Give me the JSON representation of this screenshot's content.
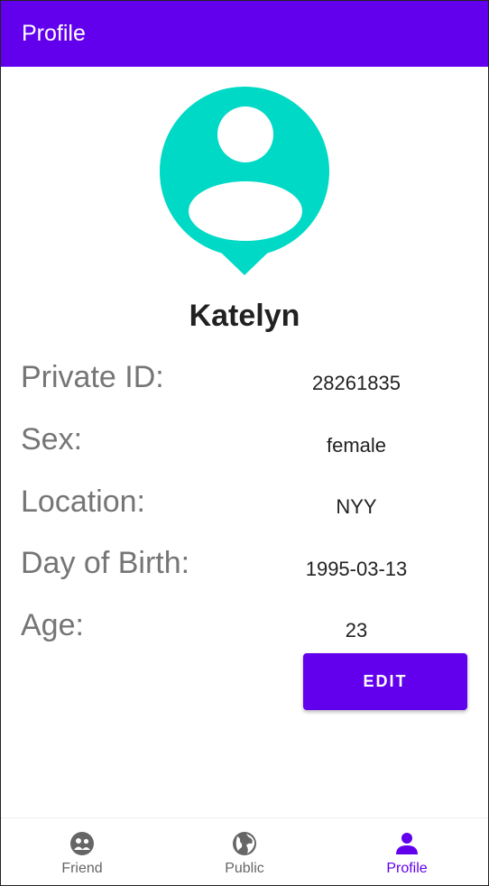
{
  "app_bar": {
    "title": "Profile"
  },
  "profile": {
    "name": "Katelyn",
    "fields": [
      {
        "label": "Private ID:",
        "value": "28261835"
      },
      {
        "label": "Sex:",
        "value": "female"
      },
      {
        "label": "Location:",
        "value": "NYY"
      },
      {
        "label": "Day of Birth:",
        "value": "1995-03-13"
      },
      {
        "label": "Age:",
        "value": "23"
      }
    ],
    "edit_label": "EDIT"
  },
  "bottom_nav": {
    "items": [
      {
        "label": "Friend",
        "icon": "friends-icon",
        "selected": false
      },
      {
        "label": "Public",
        "icon": "globe-icon",
        "selected": false
      },
      {
        "label": "Profile",
        "icon": "person-icon",
        "selected": true
      }
    ]
  },
  "colors": {
    "primary": "#6200ee",
    "avatar": "#00d9c5",
    "nav_inactive": "#666666",
    "label_gray": "#757575"
  }
}
